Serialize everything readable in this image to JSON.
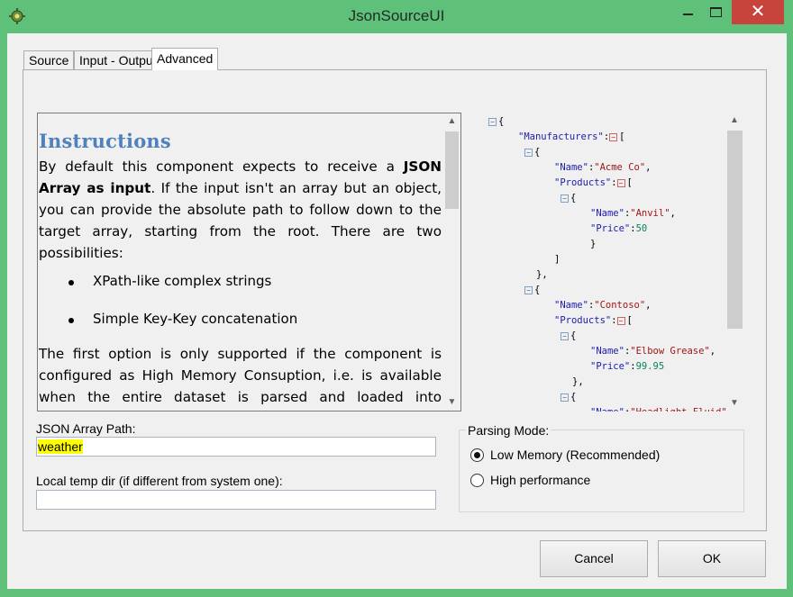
{
  "window": {
    "title": "JsonSourceUI"
  },
  "tabs": [
    {
      "label": "Source"
    },
    {
      "label": "Input - Output"
    },
    {
      "label": "Advanced"
    }
  ],
  "instructions": {
    "title": "Instructions",
    "p1_a": "By default this component expects to receive a ",
    "p1_b": "JSON Array as input",
    "p1_c": ". If the input isn't an array but an object, you can provide the absolute path to follow down to the target array, starting from the root. There are two possibilities:",
    "bullets": [
      "XPath-like complex strings",
      "Simple Key-Key concatenation"
    ],
    "p2": "The first option is only supported if the component is configured as High Memory Consuption, i.e. is available when the entire dataset is parsed and loaded into memory. If you select the Low Memory Consuption Option (which doesn't"
  },
  "json_preview": [
    {
      "indent": 0,
      "toggle": "blue",
      "text": "{"
    },
    {
      "indent": 1,
      "key": "\"Manufacturers\"",
      "sep": ":",
      "toggle": "red",
      "tail": "["
    },
    {
      "indent": 2,
      "toggle": "blue",
      "text": "{"
    },
    {
      "indent": 3,
      "key": "\"Name\"",
      "sep": ":",
      "str": "\"Acme Co\"",
      "tail": ","
    },
    {
      "indent": 3,
      "key": "\"Products\"",
      "sep": ":",
      "toggle": "red",
      "tail": "["
    },
    {
      "indent": 4,
      "toggle": "blue",
      "text": "{"
    },
    {
      "indent": 5,
      "key": "\"Name\"",
      "sep": ":",
      "str": "\"Anvil\"",
      "tail": ","
    },
    {
      "indent": 5,
      "key": "\"Price\"",
      "sep": ":",
      "num": "50"
    },
    {
      "indent": 5,
      "text": "}"
    },
    {
      "indent": 3,
      "text": "]"
    },
    {
      "indent": 2,
      "text": "},"
    },
    {
      "indent": 2,
      "toggle": "blue",
      "text": "{"
    },
    {
      "indent": 3,
      "key": "\"Name\"",
      "sep": ":",
      "str": "\"Contoso\"",
      "tail": ","
    },
    {
      "indent": 3,
      "key": "\"Products\"",
      "sep": ":",
      "toggle": "red",
      "tail": "["
    },
    {
      "indent": 4,
      "toggle": "blue",
      "text": "{"
    },
    {
      "indent": 5,
      "key": "\"Name\"",
      "sep": ":",
      "str": "\"Elbow Grease\"",
      "tail": ","
    },
    {
      "indent": 5,
      "key": "\"Price\"",
      "sep": ":",
      "num": "99.95"
    },
    {
      "indent": 4,
      "text": "},"
    },
    {
      "indent": 4,
      "toggle": "blue",
      "text": "{"
    },
    {
      "indent": 5,
      "key": "\"Name\"",
      "sep": ":",
      "str": "\"Headlight Fluid\""
    }
  ],
  "form": {
    "array_path_label": "JSON Array Path:",
    "array_path_value": "weather",
    "temp_dir_label": "Local temp dir (if different from system one):",
    "temp_dir_value": ""
  },
  "parsing_mode": {
    "title": "Parsing Mode:",
    "options": [
      {
        "label": "Low Memory (Recommended)",
        "selected": true
      },
      {
        "label": "High performance",
        "selected": false
      }
    ]
  },
  "buttons": {
    "cancel": "Cancel",
    "ok": "OK"
  },
  "icons": {
    "app": "settings-gear-icon",
    "minimize": "minimize-icon",
    "maximize": "maximize-icon",
    "close": "close-icon",
    "scroll_up": "scroll-up-icon",
    "scroll_down": "scroll-down-icon"
  },
  "colors": {
    "titlebar": "#5fc07a",
    "close": "#c7443c",
    "instructions_title": "#4f81bd",
    "highlight": "#ffff00"
  }
}
